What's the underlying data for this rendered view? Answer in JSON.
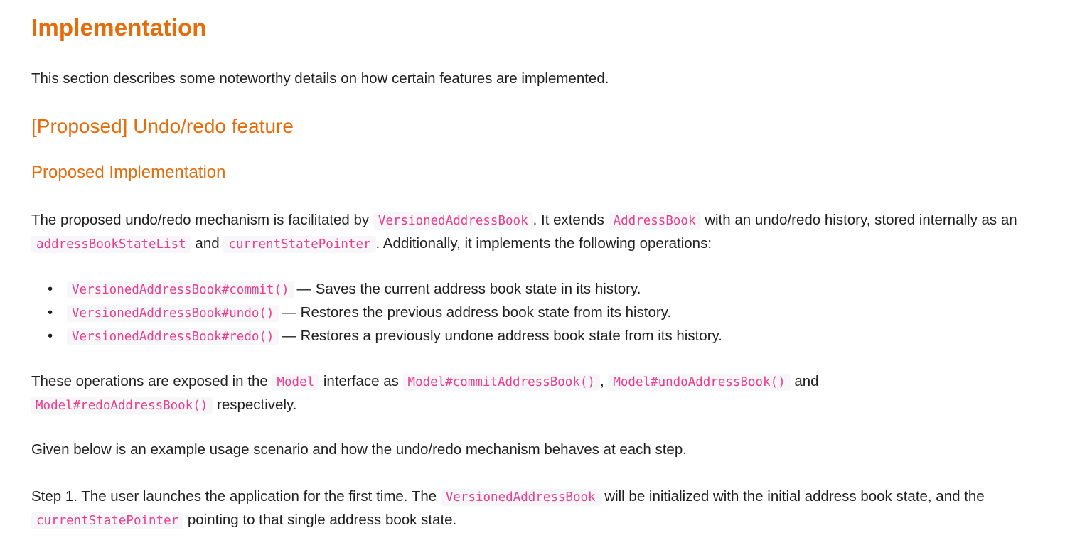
{
  "headings": {
    "h1": "Implementation",
    "h2": "[Proposed] Undo/redo feature",
    "h3": "Proposed Implementation"
  },
  "intro": "This section describes some noteworthy details on how certain features are implemented.",
  "para1": {
    "t1": "The proposed undo/redo mechanism is facilitated by ",
    "c1": "VersionedAddressBook",
    "t2": ". It extends ",
    "c2": "AddressBook",
    "t3": " with an undo/redo history, stored internally as an ",
    "c3": "addressBookStateList",
    "t4": " and ",
    "c4": "currentStatePointer",
    "t5": ". Additionally, it implements the following operations:"
  },
  "operations": [
    {
      "bullet": "•",
      "code": "VersionedAddressBook#commit()",
      "text": "— Saves the current address book state in its history."
    },
    {
      "bullet": "•",
      "code": "VersionedAddressBook#undo()",
      "text": "— Restores the previous address book state from its history."
    },
    {
      "bullet": "•",
      "code": "VersionedAddressBook#redo()",
      "text": "— Restores a previously undone address book state from its history."
    }
  ],
  "para2": {
    "t1": "These operations are exposed in the ",
    "c1": "Model",
    "t2": " interface as ",
    "c2": "Model#commitAddressBook()",
    "t3": ", ",
    "c3": "Model#undoAddressBook()",
    "t4": " and ",
    "c4": "Model#redoAddressBook()",
    "t5": " respectively."
  },
  "para3": "Given below is an example usage scenario and how the undo/redo mechanism behaves at each step.",
  "para4": {
    "t1": "Step 1. The user launches the application for the first time. The ",
    "c1": "VersionedAddressBook",
    "t2": " will be initialized with the initial address book state, and the ",
    "c2": "currentStatePointer",
    "t3": " pointing to that single address book state."
  },
  "colors": {
    "heading": "#e46c0a",
    "code_text": "#e83e8c",
    "code_bg": "#f7f7f9",
    "body_text": "#1f1f1f"
  }
}
